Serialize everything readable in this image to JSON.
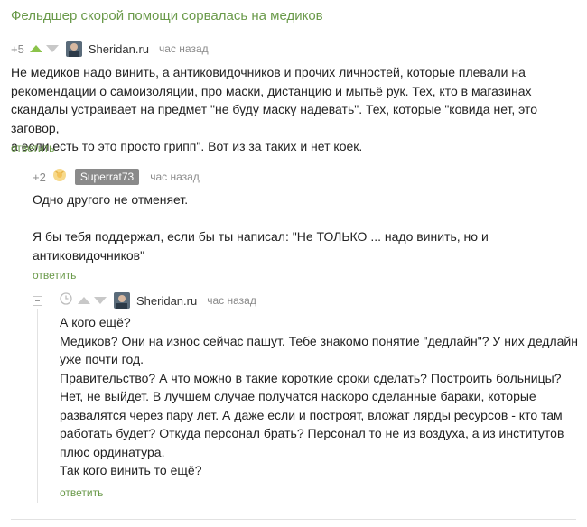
{
  "post": {
    "title": "Фельдшер скорой помощи сорвалась на медиков"
  },
  "comments": [
    {
      "rating": "+5",
      "author": "Sheridan.ru",
      "time": "час назад",
      "text": "Не медиков надо винить, а антиковидочников и прочих личностей, которые плевали на\nрекомендации о самоизоляции, про маски, дистанцию и мытьё рук. Тех, кто в магазинах\nскандалы устраивает на предмет \"не буду маску надевать\". Тех, которые \"ковида нет, это заговор,\nа если есть то это просто грипп\". Вот из за таких и нет коек.",
      "reply": "ответить"
    },
    {
      "rating": "+2",
      "author": "Superrat73",
      "time": "час назад",
      "text": "Одно другого не отменяет.\n\nЯ бы тебя поддержал, если бы ты написал: \"Не ТОЛЬКО ... надо винить, но и\nантиковидочников\"",
      "reply": "ответить"
    },
    {
      "author": "Sheridan.ru",
      "time": "час назад",
      "text": "А кого ещё?\nМедиков? Они на износ сейчас пашут. Тебе знакомо понятие \"дедлайн\"? У них дедлайн\nуже почти год.\nПравительство? А что можно в такие короткие сроки сделать? Построить больницы?\nНет, не выйдет. В лучшем случае получатся наскоро сделанные бараки, которые\nразвалятся через пару лет. А даже если и построят, вложат лярды ресурсов - кто там\nработать будет? Откуда персонал брать? Персонал то не из воздуха, а из институтов\nплюс ординатура.\nТак кого винить то ещё?",
      "reply": "ответить"
    }
  ],
  "colors": {
    "accent": "#6a9a4a",
    "vote_up": "#8bc34a",
    "muted": "#8a8a8a"
  },
  "icons": [
    "vote-up-icon",
    "vote-down-icon",
    "avatar",
    "pending-rating-icon",
    "clock-icon",
    "collapse-icon"
  ]
}
